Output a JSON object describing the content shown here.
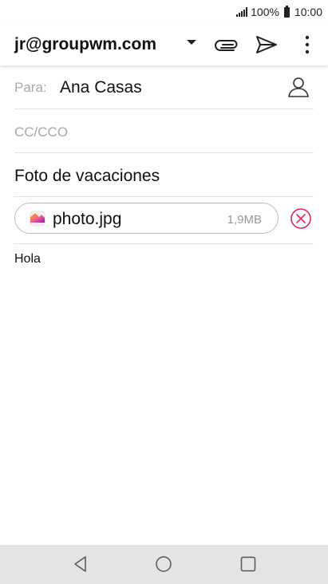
{
  "status_bar": {
    "battery_text": "100%",
    "time": "10:00"
  },
  "toolbar": {
    "account": "jr@groupwm.com",
    "icons": [
      "dropdown-icon",
      "paperclip-icon",
      "send-icon",
      "more-vert-icon"
    ]
  },
  "compose": {
    "to_label": "Para:",
    "to_value": "Ana Casas",
    "cc_placeholder": "CC/CCO",
    "subject": "Foto de vacaciones",
    "attachment": {
      "name": "photo.jpg",
      "size": "1,9MB"
    },
    "body": "Hola"
  },
  "colors": {
    "remove_accent": "#e0245e",
    "divider": "#e3e3e3",
    "nav_bar": "#e4e4e6"
  },
  "nav_bar": {
    "icons": [
      "back-icon",
      "home-icon",
      "recents-icon"
    ]
  }
}
